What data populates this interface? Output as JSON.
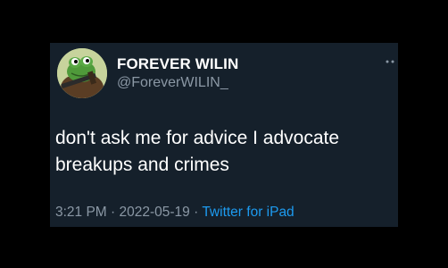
{
  "tweet": {
    "author_name": "FOREVER WILIN",
    "author_handle": "@ForeverWILIN_",
    "avatar_icon": "frog-avatar-icon",
    "text": "don't ask me for advice I advocate breakups and crimes",
    "time": "3:21 PM",
    "sep1": " · ",
    "date": "2022-05-19",
    "sep2": " · ",
    "source": "Twitter for iPad"
  },
  "colors": {
    "background": "#000000",
    "card": "#15202b",
    "primary_text": "#ffffff",
    "secondary_text": "#8b98a5",
    "link": "#1d9bf0"
  }
}
